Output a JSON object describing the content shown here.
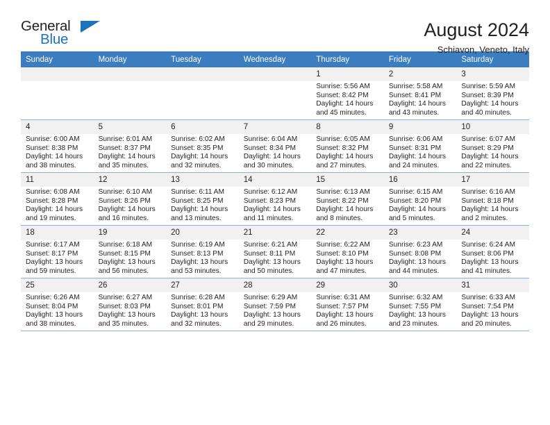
{
  "brand": {
    "line1": "General",
    "line2": "Blue",
    "triangle_icon": "brand-triangle-icon",
    "colors": {
      "blue": "#1c72bb",
      "dark": "#231f20"
    }
  },
  "header": {
    "title": "August 2024",
    "subtitle": "Schiavon, Veneto, Italy"
  },
  "theme": {
    "header_row_bg": "#3b7dbf",
    "daynum_bg": "#f1f1f1",
    "grid_line": "#8ab0d4",
    "text": "#231f20"
  },
  "weekdays": [
    {
      "label": "Sunday"
    },
    {
      "label": "Monday"
    },
    {
      "label": "Tuesday"
    },
    {
      "label": "Wednesday"
    },
    {
      "label": "Thursday"
    },
    {
      "label": "Friday"
    },
    {
      "label": "Saturday"
    }
  ],
  "weeks": [
    [
      {
        "empty": true,
        "day": ""
      },
      {
        "empty": true,
        "day": ""
      },
      {
        "empty": true,
        "day": ""
      },
      {
        "empty": true,
        "day": ""
      },
      {
        "empty": false,
        "day": "1",
        "sunrise": "Sunrise: 5:56 AM",
        "sunset": "Sunset: 8:42 PM",
        "daylight": "Daylight: 14 hours and 45 minutes."
      },
      {
        "empty": false,
        "day": "2",
        "sunrise": "Sunrise: 5:58 AM",
        "sunset": "Sunset: 8:41 PM",
        "daylight": "Daylight: 14 hours and 43 minutes."
      },
      {
        "empty": false,
        "day": "3",
        "sunrise": "Sunrise: 5:59 AM",
        "sunset": "Sunset: 8:39 PM",
        "daylight": "Daylight: 14 hours and 40 minutes."
      }
    ],
    [
      {
        "empty": false,
        "day": "4",
        "sunrise": "Sunrise: 6:00 AM",
        "sunset": "Sunset: 8:38 PM",
        "daylight": "Daylight: 14 hours and 38 minutes."
      },
      {
        "empty": false,
        "day": "5",
        "sunrise": "Sunrise: 6:01 AM",
        "sunset": "Sunset: 8:37 PM",
        "daylight": "Daylight: 14 hours and 35 minutes."
      },
      {
        "empty": false,
        "day": "6",
        "sunrise": "Sunrise: 6:02 AM",
        "sunset": "Sunset: 8:35 PM",
        "daylight": "Daylight: 14 hours and 32 minutes."
      },
      {
        "empty": false,
        "day": "7",
        "sunrise": "Sunrise: 6:04 AM",
        "sunset": "Sunset: 8:34 PM",
        "daylight": "Daylight: 14 hours and 30 minutes."
      },
      {
        "empty": false,
        "day": "8",
        "sunrise": "Sunrise: 6:05 AM",
        "sunset": "Sunset: 8:32 PM",
        "daylight": "Daylight: 14 hours and 27 minutes."
      },
      {
        "empty": false,
        "day": "9",
        "sunrise": "Sunrise: 6:06 AM",
        "sunset": "Sunset: 8:31 PM",
        "daylight": "Daylight: 14 hours and 24 minutes."
      },
      {
        "empty": false,
        "day": "10",
        "sunrise": "Sunrise: 6:07 AM",
        "sunset": "Sunset: 8:29 PM",
        "daylight": "Daylight: 14 hours and 22 minutes."
      }
    ],
    [
      {
        "empty": false,
        "day": "11",
        "sunrise": "Sunrise: 6:08 AM",
        "sunset": "Sunset: 8:28 PM",
        "daylight": "Daylight: 14 hours and 19 minutes."
      },
      {
        "empty": false,
        "day": "12",
        "sunrise": "Sunrise: 6:10 AM",
        "sunset": "Sunset: 8:26 PM",
        "daylight": "Daylight: 14 hours and 16 minutes."
      },
      {
        "empty": false,
        "day": "13",
        "sunrise": "Sunrise: 6:11 AM",
        "sunset": "Sunset: 8:25 PM",
        "daylight": "Daylight: 14 hours and 13 minutes."
      },
      {
        "empty": false,
        "day": "14",
        "sunrise": "Sunrise: 6:12 AM",
        "sunset": "Sunset: 8:23 PM",
        "daylight": "Daylight: 14 hours and 11 minutes."
      },
      {
        "empty": false,
        "day": "15",
        "sunrise": "Sunrise: 6:13 AM",
        "sunset": "Sunset: 8:22 PM",
        "daylight": "Daylight: 14 hours and 8 minutes."
      },
      {
        "empty": false,
        "day": "16",
        "sunrise": "Sunrise: 6:15 AM",
        "sunset": "Sunset: 8:20 PM",
        "daylight": "Daylight: 14 hours and 5 minutes."
      },
      {
        "empty": false,
        "day": "17",
        "sunrise": "Sunrise: 6:16 AM",
        "sunset": "Sunset: 8:18 PM",
        "daylight": "Daylight: 14 hours and 2 minutes."
      }
    ],
    [
      {
        "empty": false,
        "day": "18",
        "sunrise": "Sunrise: 6:17 AM",
        "sunset": "Sunset: 8:17 PM",
        "daylight": "Daylight: 13 hours and 59 minutes."
      },
      {
        "empty": false,
        "day": "19",
        "sunrise": "Sunrise: 6:18 AM",
        "sunset": "Sunset: 8:15 PM",
        "daylight": "Daylight: 13 hours and 56 minutes."
      },
      {
        "empty": false,
        "day": "20",
        "sunrise": "Sunrise: 6:19 AM",
        "sunset": "Sunset: 8:13 PM",
        "daylight": "Daylight: 13 hours and 53 minutes."
      },
      {
        "empty": false,
        "day": "21",
        "sunrise": "Sunrise: 6:21 AM",
        "sunset": "Sunset: 8:11 PM",
        "daylight": "Daylight: 13 hours and 50 minutes."
      },
      {
        "empty": false,
        "day": "22",
        "sunrise": "Sunrise: 6:22 AM",
        "sunset": "Sunset: 8:10 PM",
        "daylight": "Daylight: 13 hours and 47 minutes."
      },
      {
        "empty": false,
        "day": "23",
        "sunrise": "Sunrise: 6:23 AM",
        "sunset": "Sunset: 8:08 PM",
        "daylight": "Daylight: 13 hours and 44 minutes."
      },
      {
        "empty": false,
        "day": "24",
        "sunrise": "Sunrise: 6:24 AM",
        "sunset": "Sunset: 8:06 PM",
        "daylight": "Daylight: 13 hours and 41 minutes."
      }
    ],
    [
      {
        "empty": false,
        "day": "25",
        "sunrise": "Sunrise: 6:26 AM",
        "sunset": "Sunset: 8:04 PM",
        "daylight": "Daylight: 13 hours and 38 minutes."
      },
      {
        "empty": false,
        "day": "26",
        "sunrise": "Sunrise: 6:27 AM",
        "sunset": "Sunset: 8:03 PM",
        "daylight": "Daylight: 13 hours and 35 minutes."
      },
      {
        "empty": false,
        "day": "27",
        "sunrise": "Sunrise: 6:28 AM",
        "sunset": "Sunset: 8:01 PM",
        "daylight": "Daylight: 13 hours and 32 minutes."
      },
      {
        "empty": false,
        "day": "28",
        "sunrise": "Sunrise: 6:29 AM",
        "sunset": "Sunset: 7:59 PM",
        "daylight": "Daylight: 13 hours and 29 minutes."
      },
      {
        "empty": false,
        "day": "29",
        "sunrise": "Sunrise: 6:31 AM",
        "sunset": "Sunset: 7:57 PM",
        "daylight": "Daylight: 13 hours and 26 minutes."
      },
      {
        "empty": false,
        "day": "30",
        "sunrise": "Sunrise: 6:32 AM",
        "sunset": "Sunset: 7:55 PM",
        "daylight": "Daylight: 13 hours and 23 minutes."
      },
      {
        "empty": false,
        "day": "31",
        "sunrise": "Sunrise: 6:33 AM",
        "sunset": "Sunset: 7:54 PM",
        "daylight": "Daylight: 13 hours and 20 minutes."
      }
    ]
  ]
}
